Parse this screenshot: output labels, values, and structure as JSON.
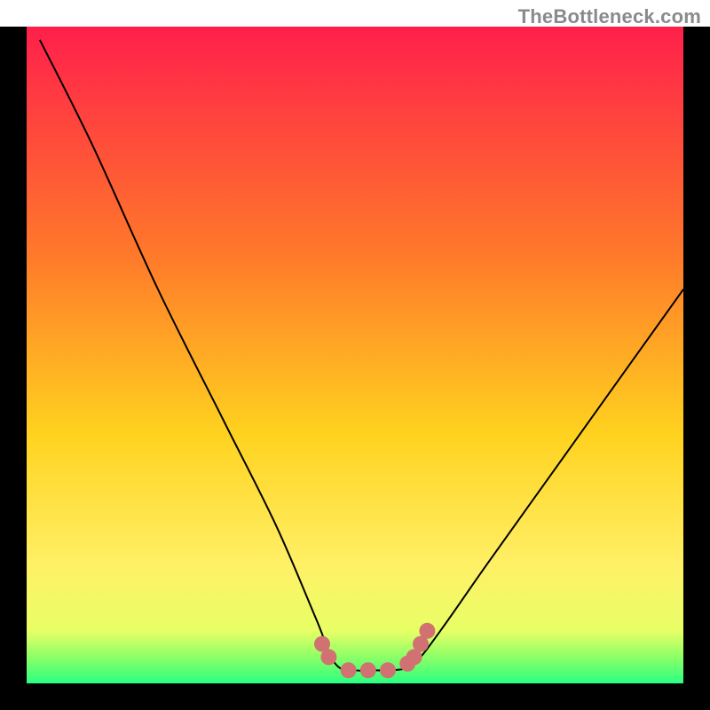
{
  "attribution": "TheBottleneck.com",
  "colors": {
    "frame_black": "#000000",
    "curve_black": "#000000",
    "marker_red": "#d27171",
    "gradient_top": "#ff1f4b",
    "gradient_upper_mid": "#ff7a2a",
    "gradient_mid": "#ffd21f",
    "gradient_lower_mid": "#fff066",
    "gradient_green": "#2aff82"
  },
  "chart_data": {
    "type": "line",
    "title": "",
    "xlabel": "",
    "ylabel": "",
    "xlim": [
      0,
      100
    ],
    "ylim": [
      0,
      100
    ],
    "grid": false,
    "legend": false,
    "notes": "V-shaped bottleneck curve. y ~ percent bottleneck (0 at bottom / green, 100 at top / red). Minimum plateau around x=47-59 at y≈2. Background is a vertical rainbow gradient from red (high bottleneck) to green (low bottleneck).",
    "series": [
      {
        "name": "bottleneck_curve",
        "x": [
          2,
          10,
          20,
          30,
          38,
          44,
          47,
          50,
          53,
          56,
          59,
          63,
          70,
          80,
          90,
          100
        ],
        "values": [
          98,
          82,
          60,
          40,
          24,
          10,
          3,
          2,
          2,
          2,
          3,
          8,
          18,
          32,
          46,
          60
        ]
      }
    ],
    "markers": {
      "name": "highlight_points",
      "x": [
        45,
        46,
        49,
        52,
        55,
        58,
        59,
        60,
        61
      ],
      "values": [
        6,
        4,
        2,
        2,
        2,
        3,
        4,
        6,
        8
      ]
    },
    "gradient_stops": [
      {
        "pct": 0,
        "color": "#ff1f4b"
      },
      {
        "pct": 35,
        "color": "#ff7a2a"
      },
      {
        "pct": 62,
        "color": "#ffd21f"
      },
      {
        "pct": 82,
        "color": "#fff066"
      },
      {
        "pct": 92,
        "color": "#e8ff66"
      },
      {
        "pct": 96,
        "color": "#8cff66"
      },
      {
        "pct": 100,
        "color": "#2aff82"
      }
    ]
  }
}
